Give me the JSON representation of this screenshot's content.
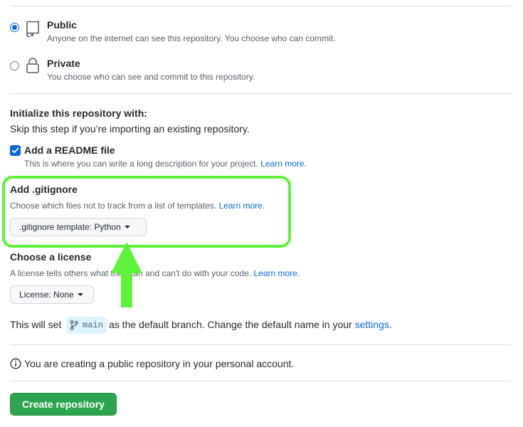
{
  "visibility": {
    "public": {
      "title": "Public",
      "description": "Anyone on the internet can see this repository. You choose who can commit.",
      "selected": true
    },
    "private": {
      "title": "Private",
      "description": "You choose who can see and commit to this repository.",
      "selected": false
    }
  },
  "initialize": {
    "heading": "Initialize this repository with:",
    "subheading": "Skip this step if you’re importing an existing repository.",
    "readme": {
      "label": "Add a README file",
      "description": "This is where you can write a long description for your project.",
      "link": "Learn more.",
      "checked": true
    },
    "gitignore": {
      "heading": "Add .gitignore",
      "description": "Choose which files not to track from a list of templates.",
      "link": "Learn more.",
      "button_label": ".gitignore template: Python"
    },
    "license": {
      "heading": "Choose a license",
      "description": "A license tells others what they can and can't do with your code.",
      "link": "Learn more.",
      "button_label": "License: None"
    }
  },
  "branch_note": {
    "prefix": "This will set",
    "branch": "main",
    "middle": "as the default branch. Change the default name in your",
    "link": "settings",
    "suffix": "."
  },
  "info": {
    "text": "You are creating a public repository in your personal account."
  },
  "create_button": {
    "label": "Create repository"
  },
  "annotation": {
    "highlight_color": "#5ff23a"
  }
}
